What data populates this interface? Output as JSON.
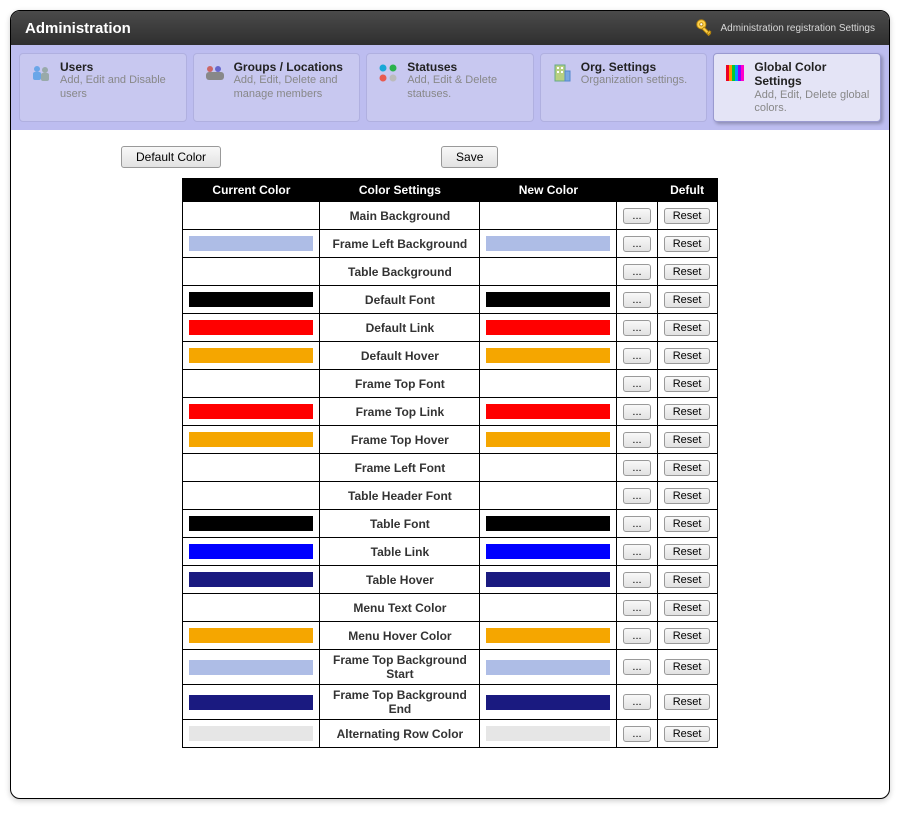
{
  "header": {
    "title": "Administration",
    "breadcrumb": "Administration registration Settings"
  },
  "tabs": {
    "users": {
      "title": "Users",
      "sub": "Add, Edit and Disable users"
    },
    "groups": {
      "title": "Groups / Locations",
      "sub": "Add, Edit, Delete and manage members"
    },
    "statuses": {
      "title": "Statuses",
      "sub": "Add, Edit & Delete statuses."
    },
    "org": {
      "title": "Org. Settings",
      "sub": "Organization settings."
    },
    "colors": {
      "title": "Global Color Settings",
      "sub": "Add, Edit, Delete global colors."
    }
  },
  "buttons": {
    "default_color": "Default Color",
    "save": "Save",
    "pick": "...",
    "reset": "Reset"
  },
  "table": {
    "headers": {
      "current": "Current Color",
      "settings": "Color Settings",
      "new": "New Color",
      "pick": "",
      "default": "Defult"
    },
    "rows": [
      {
        "label": "Main Background",
        "current": "#ffffff",
        "new": "#ffffff",
        "show_current": false,
        "show_new": false
      },
      {
        "label": "Frame Left Background",
        "current": "#aebde6",
        "new": "#aebde6",
        "show_current": true,
        "show_new": true
      },
      {
        "label": "Table Background",
        "current": "#ffffff",
        "new": "#ffffff",
        "show_current": false,
        "show_new": false
      },
      {
        "label": "Default Font",
        "current": "#000000",
        "new": "#000000",
        "show_current": true,
        "show_new": true
      },
      {
        "label": "Default Link",
        "current": "#ff0000",
        "new": "#ff0000",
        "show_current": true,
        "show_new": true
      },
      {
        "label": "Default Hover",
        "current": "#f5a600",
        "new": "#f5a600",
        "show_current": true,
        "show_new": true
      },
      {
        "label": "Frame Top Font",
        "current": "#ffffff",
        "new": "#ffffff",
        "show_current": false,
        "show_new": false
      },
      {
        "label": "Frame Top Link",
        "current": "#ff0000",
        "new": "#ff0000",
        "show_current": true,
        "show_new": true
      },
      {
        "label": "Frame Top Hover",
        "current": "#f5a600",
        "new": "#f5a600",
        "show_current": true,
        "show_new": true
      },
      {
        "label": "Frame Left Font",
        "current": "#ffffff",
        "new": "#ffffff",
        "show_current": false,
        "show_new": false
      },
      {
        "label": "Table Header Font",
        "current": "#ffffff",
        "new": "#ffffff",
        "show_current": false,
        "show_new": false
      },
      {
        "label": "Table Font",
        "current": "#000000",
        "new": "#000000",
        "show_current": true,
        "show_new": true
      },
      {
        "label": "Table Link",
        "current": "#0000ff",
        "new": "#0000ff",
        "show_current": true,
        "show_new": true
      },
      {
        "label": "Table Hover",
        "current": "#1a1a80",
        "new": "#1a1a80",
        "show_current": true,
        "show_new": true
      },
      {
        "label": "Menu Text Color",
        "current": "#ffffff",
        "new": "#ffffff",
        "show_current": false,
        "show_new": false
      },
      {
        "label": "Menu Hover Color",
        "current": "#f5a600",
        "new": "#f5a600",
        "show_current": true,
        "show_new": true
      },
      {
        "label": "Frame Top Background Start",
        "current": "#aebde6",
        "new": "#aebde6",
        "show_current": true,
        "show_new": true
      },
      {
        "label": "Frame Top Background End",
        "current": "#1a1a80",
        "new": "#1a1a80",
        "show_current": true,
        "show_new": true
      },
      {
        "label": "Alternating Row Color",
        "current": "#e6e6e6",
        "new": "#e6e6e6",
        "show_current": true,
        "show_new": true
      }
    ]
  }
}
